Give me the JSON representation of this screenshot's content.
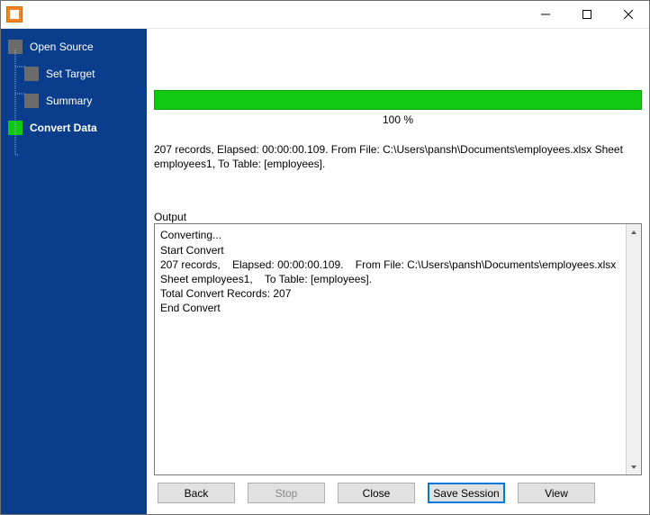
{
  "sidebar": {
    "items": [
      {
        "label": "Open Source"
      },
      {
        "label": "Set Target"
      },
      {
        "label": "Summary"
      },
      {
        "label": "Convert Data"
      }
    ]
  },
  "progress": {
    "percent_label": "100 %"
  },
  "info_line": "207 records,    Elapsed: 00:00:00.109.    From File: C:\\Users\\pansh\\Documents\\employees.xlsx Sheet employees1,    To Table: [employees].",
  "output": {
    "label": "Output",
    "text": "Converting...\nStart Convert\n207 records,    Elapsed: 00:00:00.109.    From File: C:\\Users\\pansh\\Documents\\employees.xlsx Sheet employees1,    To Table: [employees].\nTotal Convert Records: 207\nEnd Convert"
  },
  "buttons": {
    "back": "Back",
    "stop": "Stop",
    "close": "Close",
    "save_session": "Save Session",
    "view": "View"
  }
}
